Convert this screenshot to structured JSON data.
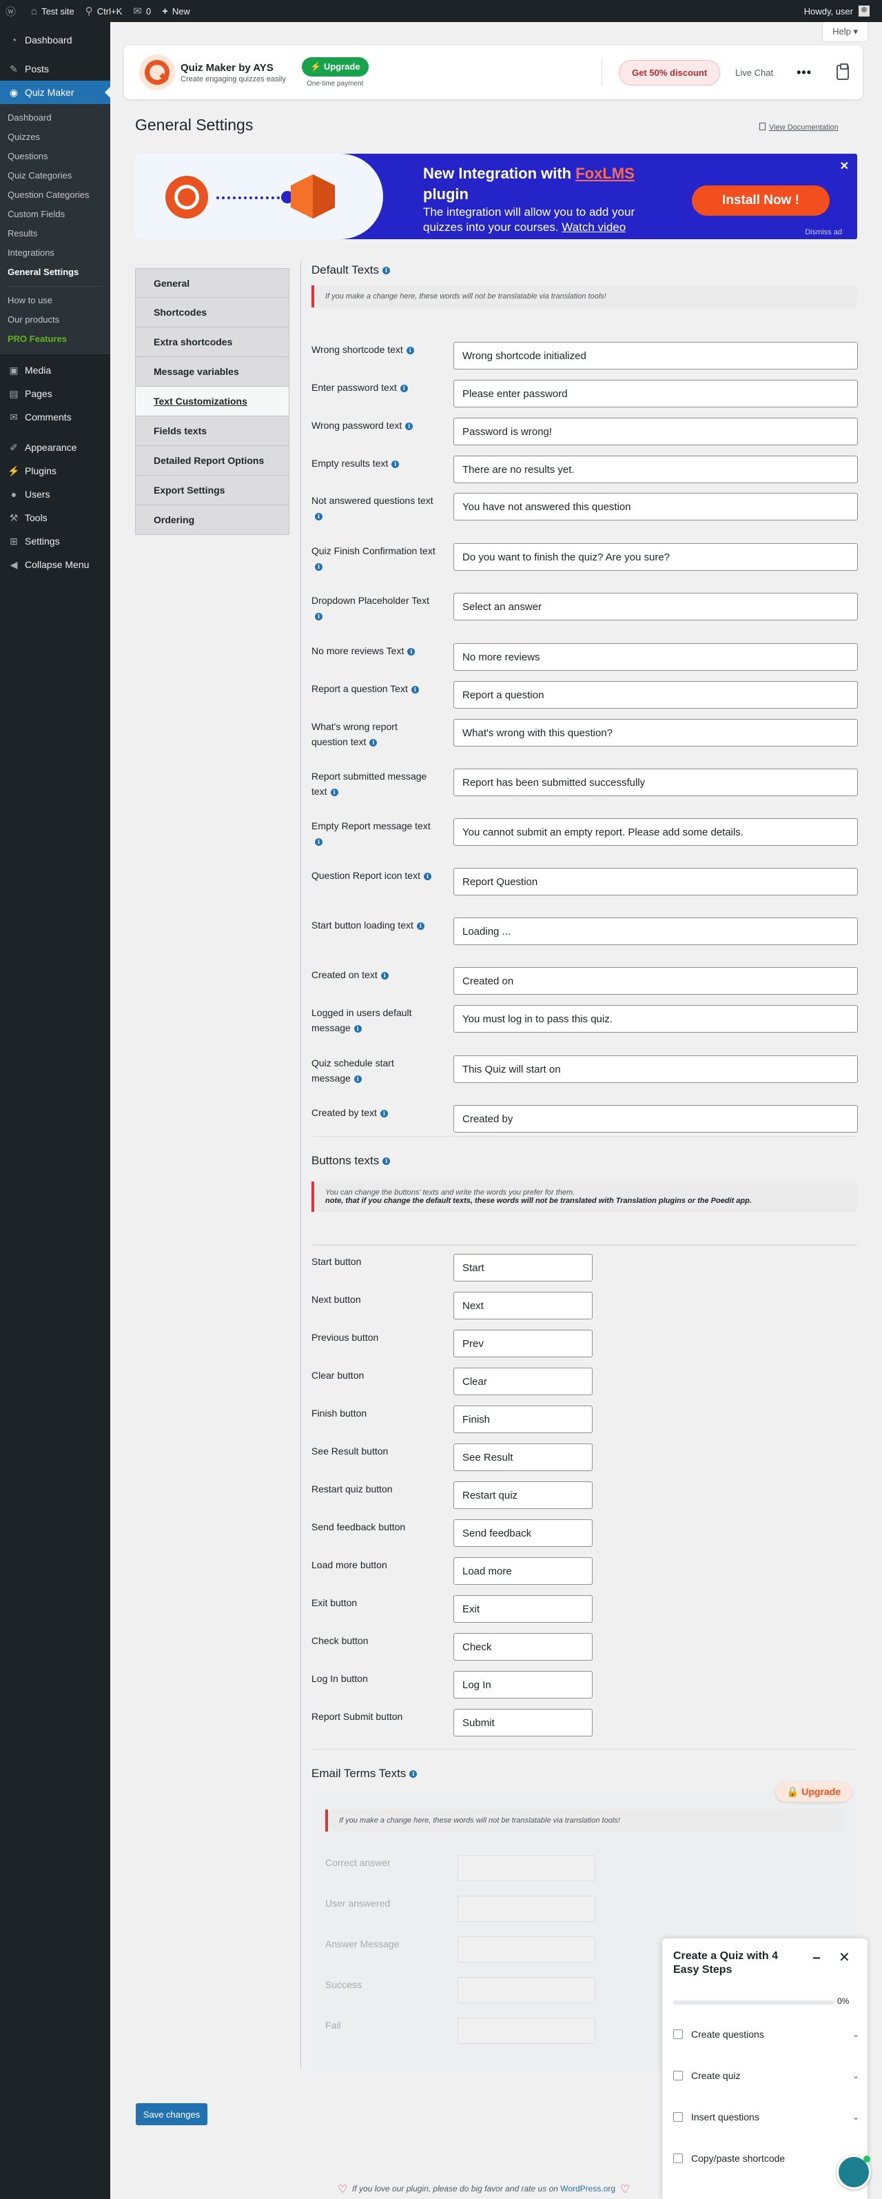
{
  "adminbar": {
    "site": "Test site",
    "search": "Ctrl+K",
    "comments": "0",
    "new": "New",
    "howdy": "Howdy, user"
  },
  "sidebar": {
    "items": [
      {
        "label": "Dashboard",
        "icon": "dashboard-icon"
      },
      {
        "label": "Posts",
        "icon": "pin-icon"
      },
      {
        "label": "Quiz Maker",
        "icon": "quiz-maker-icon"
      }
    ],
    "quiz_sub": [
      "Dashboard",
      "Quizzes",
      "Questions",
      "Quiz Categories",
      "Question Categories",
      "Custom Fields",
      "Results",
      "Integrations",
      "General Settings"
    ],
    "quiz_sub2": [
      "How to use",
      "Our products",
      "PRO Features"
    ],
    "items2": [
      {
        "label": "Media",
        "icon": "media-icon"
      },
      {
        "label": "Pages",
        "icon": "pages-icon"
      },
      {
        "label": "Comments",
        "icon": "comments-icon"
      },
      {
        "label": "Appearance",
        "icon": "appearance-icon"
      },
      {
        "label": "Plugins",
        "icon": "plugins-icon"
      },
      {
        "label": "Users",
        "icon": "users-icon"
      },
      {
        "label": "Tools",
        "icon": "tools-icon"
      },
      {
        "label": "Settings",
        "icon": "settings-icon"
      },
      {
        "label": "Collapse Menu",
        "icon": "collapse-icon"
      }
    ]
  },
  "help": "Help ▾",
  "topcard": {
    "brand_title": "Quiz Maker by AYS",
    "brand_sub": "Create engaging quizzes easily",
    "upgrade": "Upgrade",
    "upgrade_sub": "One-time payment",
    "discount": "Get 50% discount",
    "live_chat": "Live Chat",
    "more": "•••"
  },
  "page": {
    "title": "General Settings",
    "view_doc": "View Documentation"
  },
  "banner": {
    "title_pre": "New Integration with ",
    "title_fox": "FoxLMS",
    "title_post": " plugin",
    "desc": "The integration will allow you to add your quizzes into your courses. ",
    "desc_link": "Watch video",
    "install": "Install Now !",
    "close": "✕",
    "dismiss": "Dismiss ad"
  },
  "tabs": [
    "General",
    "Shortcodes",
    "Extra shortcodes",
    "Message variables",
    "Text Customizations",
    "Fields texts",
    "Detailed Report Options",
    "Export Settings",
    "Ordering"
  ],
  "default_texts": {
    "title": "Default Texts",
    "notice": "If you make a change here, these words will not be translatable via translation tools!",
    "rows": [
      {
        "label": "Wrong shortcode text",
        "value": "Wrong shortcode initialized"
      },
      {
        "label": "Enter password text",
        "value": "Please enter password"
      },
      {
        "label": "Wrong password text",
        "value": "Password is wrong!"
      },
      {
        "label": "Empty results text",
        "value": "There are no results yet."
      },
      {
        "label": "Not answered questions text",
        "value": "You have not answered this question"
      },
      {
        "label": "Quiz Finish Confirmation text",
        "value": "Do you want to finish the quiz? Are you sure?"
      },
      {
        "label": "Dropdown Placeholder Text",
        "value": "Select an answer"
      },
      {
        "label": "No more reviews Text",
        "value": "No more reviews"
      },
      {
        "label": "Report a question Text",
        "value": "Report a question"
      },
      {
        "label": "What's wrong report question text",
        "value": "What's wrong with this question?"
      },
      {
        "label": "Report submitted message text",
        "value": "Report has been submitted successfully"
      },
      {
        "label": "Empty Report message text",
        "value": "You cannot submit an empty report. Please add some details."
      },
      {
        "label": "Question Report icon text",
        "value": "Report Question"
      },
      {
        "label": "Start button loading text",
        "value": "Loading ..."
      },
      {
        "label": "Created on text",
        "value": "Created on"
      },
      {
        "label": "Logged in users default message",
        "value": "You must log in to pass this quiz."
      },
      {
        "label": "Quiz schedule start message",
        "value": "This Quiz will start on"
      },
      {
        "label": "Created by text",
        "value": "Created by"
      }
    ]
  },
  "buttons_texts": {
    "title": "Buttons texts",
    "notice1": "You can change the buttons' texts and write the words you prefer for them.",
    "notice2": "note, that if you change the default texts, these words will not be translated with Translation plugins or the Poedit app.",
    "rows": [
      {
        "label": "Start button",
        "value": "Start"
      },
      {
        "label": "Next button",
        "value": "Next"
      },
      {
        "label": "Previous button",
        "value": "Prev"
      },
      {
        "label": "Clear button",
        "value": "Clear"
      },
      {
        "label": "Finish button",
        "value": "Finish"
      },
      {
        "label": "See Result button",
        "value": "See Result"
      },
      {
        "label": "Restart quiz button",
        "value": "Restart quiz"
      },
      {
        "label": "Send feedback button",
        "value": "Send feedback"
      },
      {
        "label": "Load more button",
        "value": "Load more"
      },
      {
        "label": "Exit button",
        "value": "Exit"
      },
      {
        "label": "Check button",
        "value": "Check"
      },
      {
        "label": "Log In button",
        "value": "Log In"
      },
      {
        "label": "Report Submit button",
        "value": "Submit"
      }
    ]
  },
  "email_terms": {
    "title": "Email Terms Texts",
    "upgrade": "Upgrade",
    "notice": "If you make a change here, these words will not be translatable via translation tools!",
    "rows": [
      "Correct answer",
      "User answered",
      "Answer Message",
      "Success",
      "Fail"
    ]
  },
  "save": "Save changes",
  "footer": {
    "text": "If you love our plugin, please do big favor and rate us on ",
    "link": "WordPress.org"
  },
  "steps": {
    "title": "Create a Quiz with 4 Easy Steps",
    "progress": 0,
    "progress_label": "0%",
    "items": [
      "Create questions",
      "Create quiz",
      "Insert questions",
      "Copy/paste shortcode"
    ]
  }
}
